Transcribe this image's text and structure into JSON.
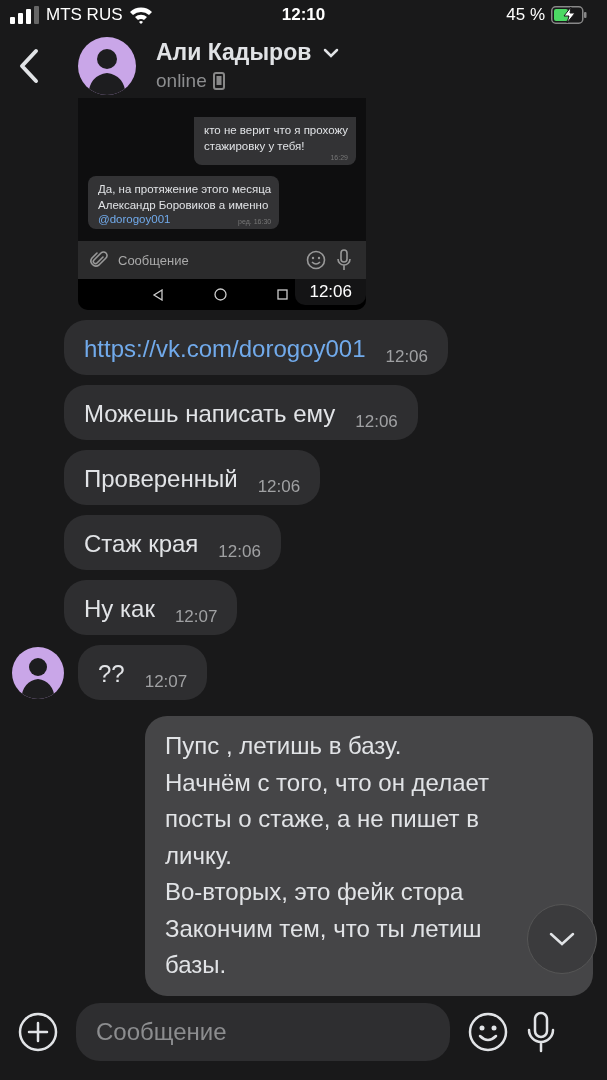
{
  "status_bar": {
    "carrier": "MTS RUS",
    "time": "12:10",
    "battery": "45 %",
    "charging": true
  },
  "header": {
    "name": "Али Кадыров",
    "status": "online"
  },
  "screenshot": {
    "messages": [
      {
        "outgoing": true,
        "text": "кто не верит что я прохожу\nстажировку у тебя!",
        "time": "16:29"
      },
      {
        "outgoing": false,
        "text": "Да, на протяжение этого месяца\nАлександр Боровиков а именно",
        "link": "@dorogoy001",
        "time": "ред. 16:30"
      }
    ],
    "composer_placeholder": "Сообщение",
    "time": "12:06"
  },
  "messages": [
    {
      "kind": "link",
      "outgoing": false,
      "show_avatar": false,
      "text": "https://vk.com/dorogoy001",
      "time": "12:06"
    },
    {
      "kind": "text",
      "outgoing": false,
      "show_avatar": false,
      "text": "Можешь написать ему",
      "time": "12:06"
    },
    {
      "kind": "text",
      "outgoing": false,
      "show_avatar": false,
      "text": "Проверенный",
      "time": "12:06"
    },
    {
      "kind": "text",
      "outgoing": false,
      "show_avatar": false,
      "text": "Стаж края",
      "time": "12:06"
    },
    {
      "kind": "text",
      "outgoing": false,
      "show_avatar": false,
      "text": "Ну как",
      "time": "12:07"
    },
    {
      "kind": "text",
      "outgoing": false,
      "show_avatar": true,
      "text": "??",
      "time": "12:07"
    },
    {
      "kind": "text",
      "outgoing": true,
      "show_avatar": false,
      "text": "Пупс , летишь в базу.\nНачнём с того, что он делает\nпосты о стаже, а не пишет в\nличку.\nВо-вторых, это фейк стора\nЗакончим тем, что ты летиш\nбазы."
    }
  ],
  "composer": {
    "placeholder": "Сообщение"
  }
}
